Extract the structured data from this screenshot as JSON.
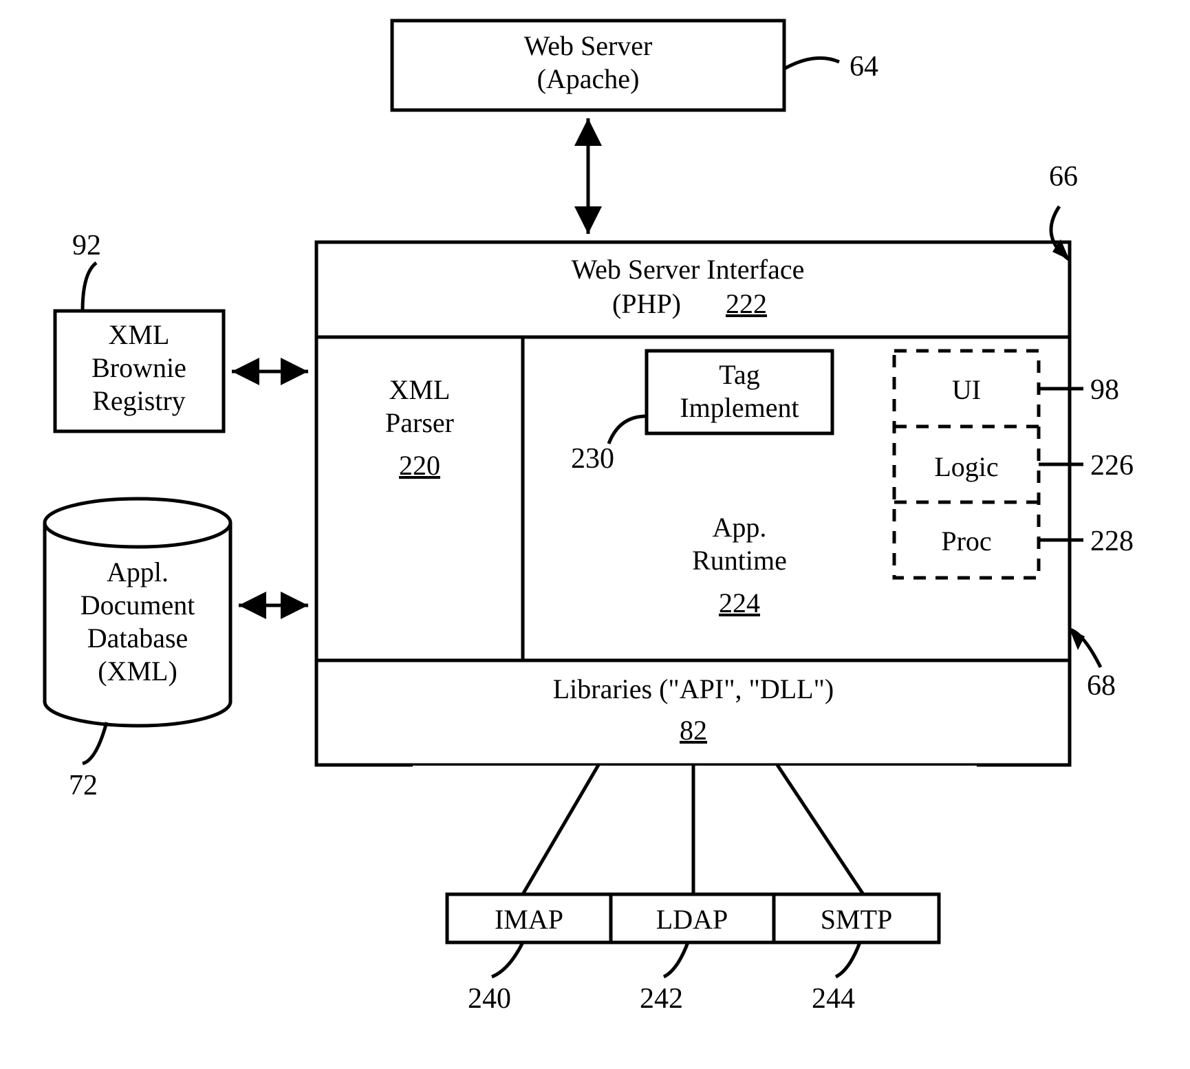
{
  "boxes": {
    "web_server": {
      "line1": "Web Server",
      "line2": "(Apache)",
      "ref": "64"
    },
    "interface": {
      "line1": "Web Server Interface",
      "line2": "(PHP)",
      "ref": "222"
    },
    "xml_parser": {
      "line1": "XML",
      "line2": "Parser",
      "ref": "220"
    },
    "tag_impl": {
      "line1": "Tag",
      "line2": "Implement",
      "ref": "230"
    },
    "app_runtime": {
      "line1": "App.",
      "line2": "Runtime",
      "ref": "224"
    },
    "ui": {
      "label": "UI",
      "ref": "98"
    },
    "logic": {
      "label": "Logic",
      "ref": "226"
    },
    "proc": {
      "label": "Proc",
      "ref": "228"
    },
    "libraries": {
      "line1": "Libraries (\"API\", \"DLL\")",
      "ref": "82"
    },
    "xml_registry": {
      "line1": "XML",
      "line2": "Brownie",
      "line3": "Registry",
      "ref": "92"
    },
    "db": {
      "line1": "Appl.",
      "line2": "Document",
      "line3": "Database",
      "line4": "(XML)",
      "ref": "72"
    },
    "imap": {
      "label": "IMAP",
      "ref": "240"
    },
    "ldap": {
      "label": "LDAP",
      "ref": "242"
    },
    "smtp": {
      "label": "SMTP",
      "ref": "244"
    }
  },
  "outer_refs": {
    "container": "66",
    "mid_side": "68"
  }
}
